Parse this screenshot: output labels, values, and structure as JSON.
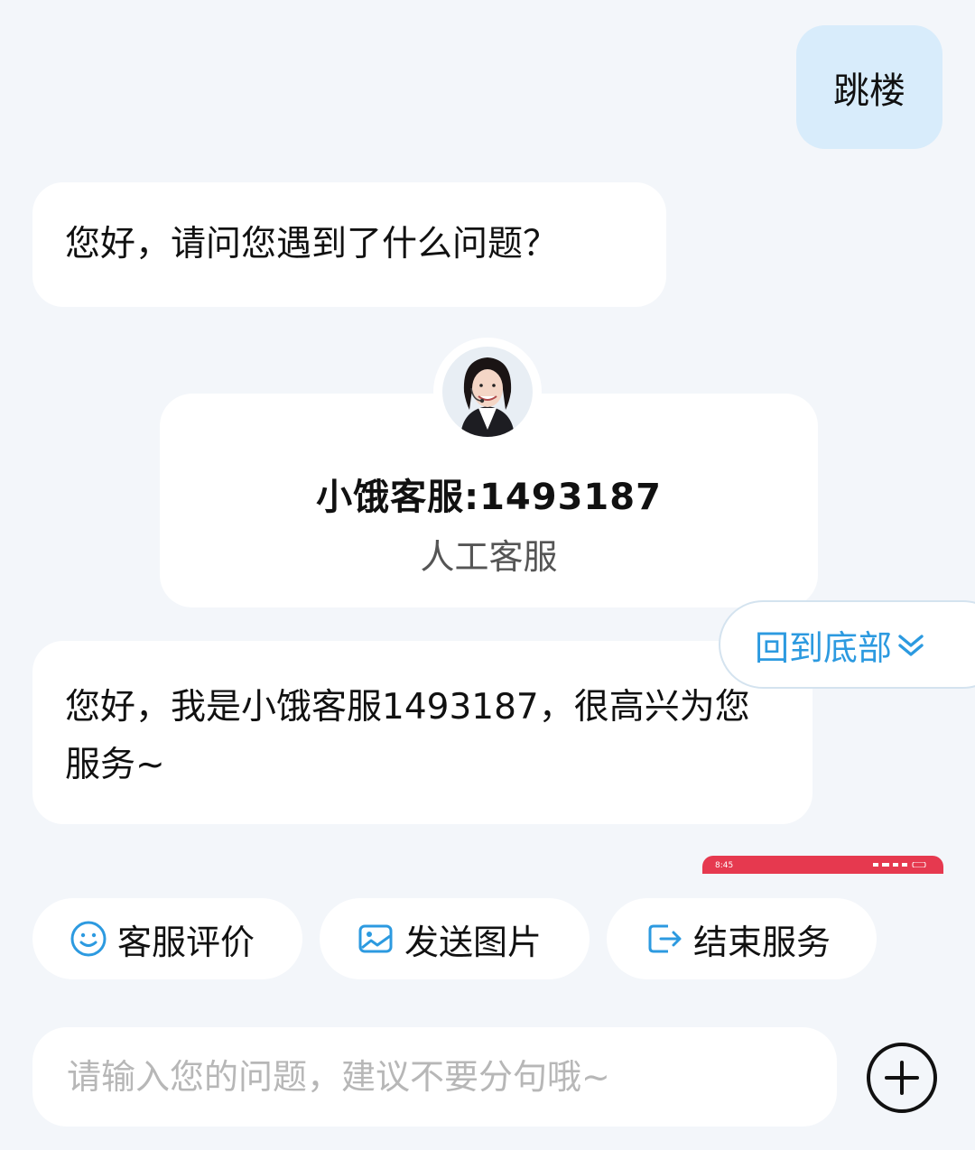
{
  "messages": {
    "user_1": "跳楼",
    "bot_1": "您好，请问您遇到了什么问题？",
    "agent_1": "您好，我是小饿客服1493187，很高兴为您服务~"
  },
  "agent_card": {
    "name": "小饿客服:1493187",
    "role": "人工客服"
  },
  "scroll_button": {
    "label": "回到底部",
    "icon": "double-chevron-down-icon"
  },
  "preview_strip": {
    "time": "8:45"
  },
  "quick_actions": [
    {
      "label": "客服评价",
      "icon": "smile-icon"
    },
    {
      "label": "发送图片",
      "icon": "image-icon"
    },
    {
      "label": "结束服务",
      "icon": "exit-icon"
    }
  ],
  "composer": {
    "placeholder": "请输入您的问题，建议不要分句哦~",
    "plus_icon": "plus-circle-icon"
  },
  "colors": {
    "background": "#f3f6fa",
    "user_bubble": "#d8ecfb",
    "accent_blue": "#2c9ae0",
    "strip_red": "#e6394f"
  }
}
